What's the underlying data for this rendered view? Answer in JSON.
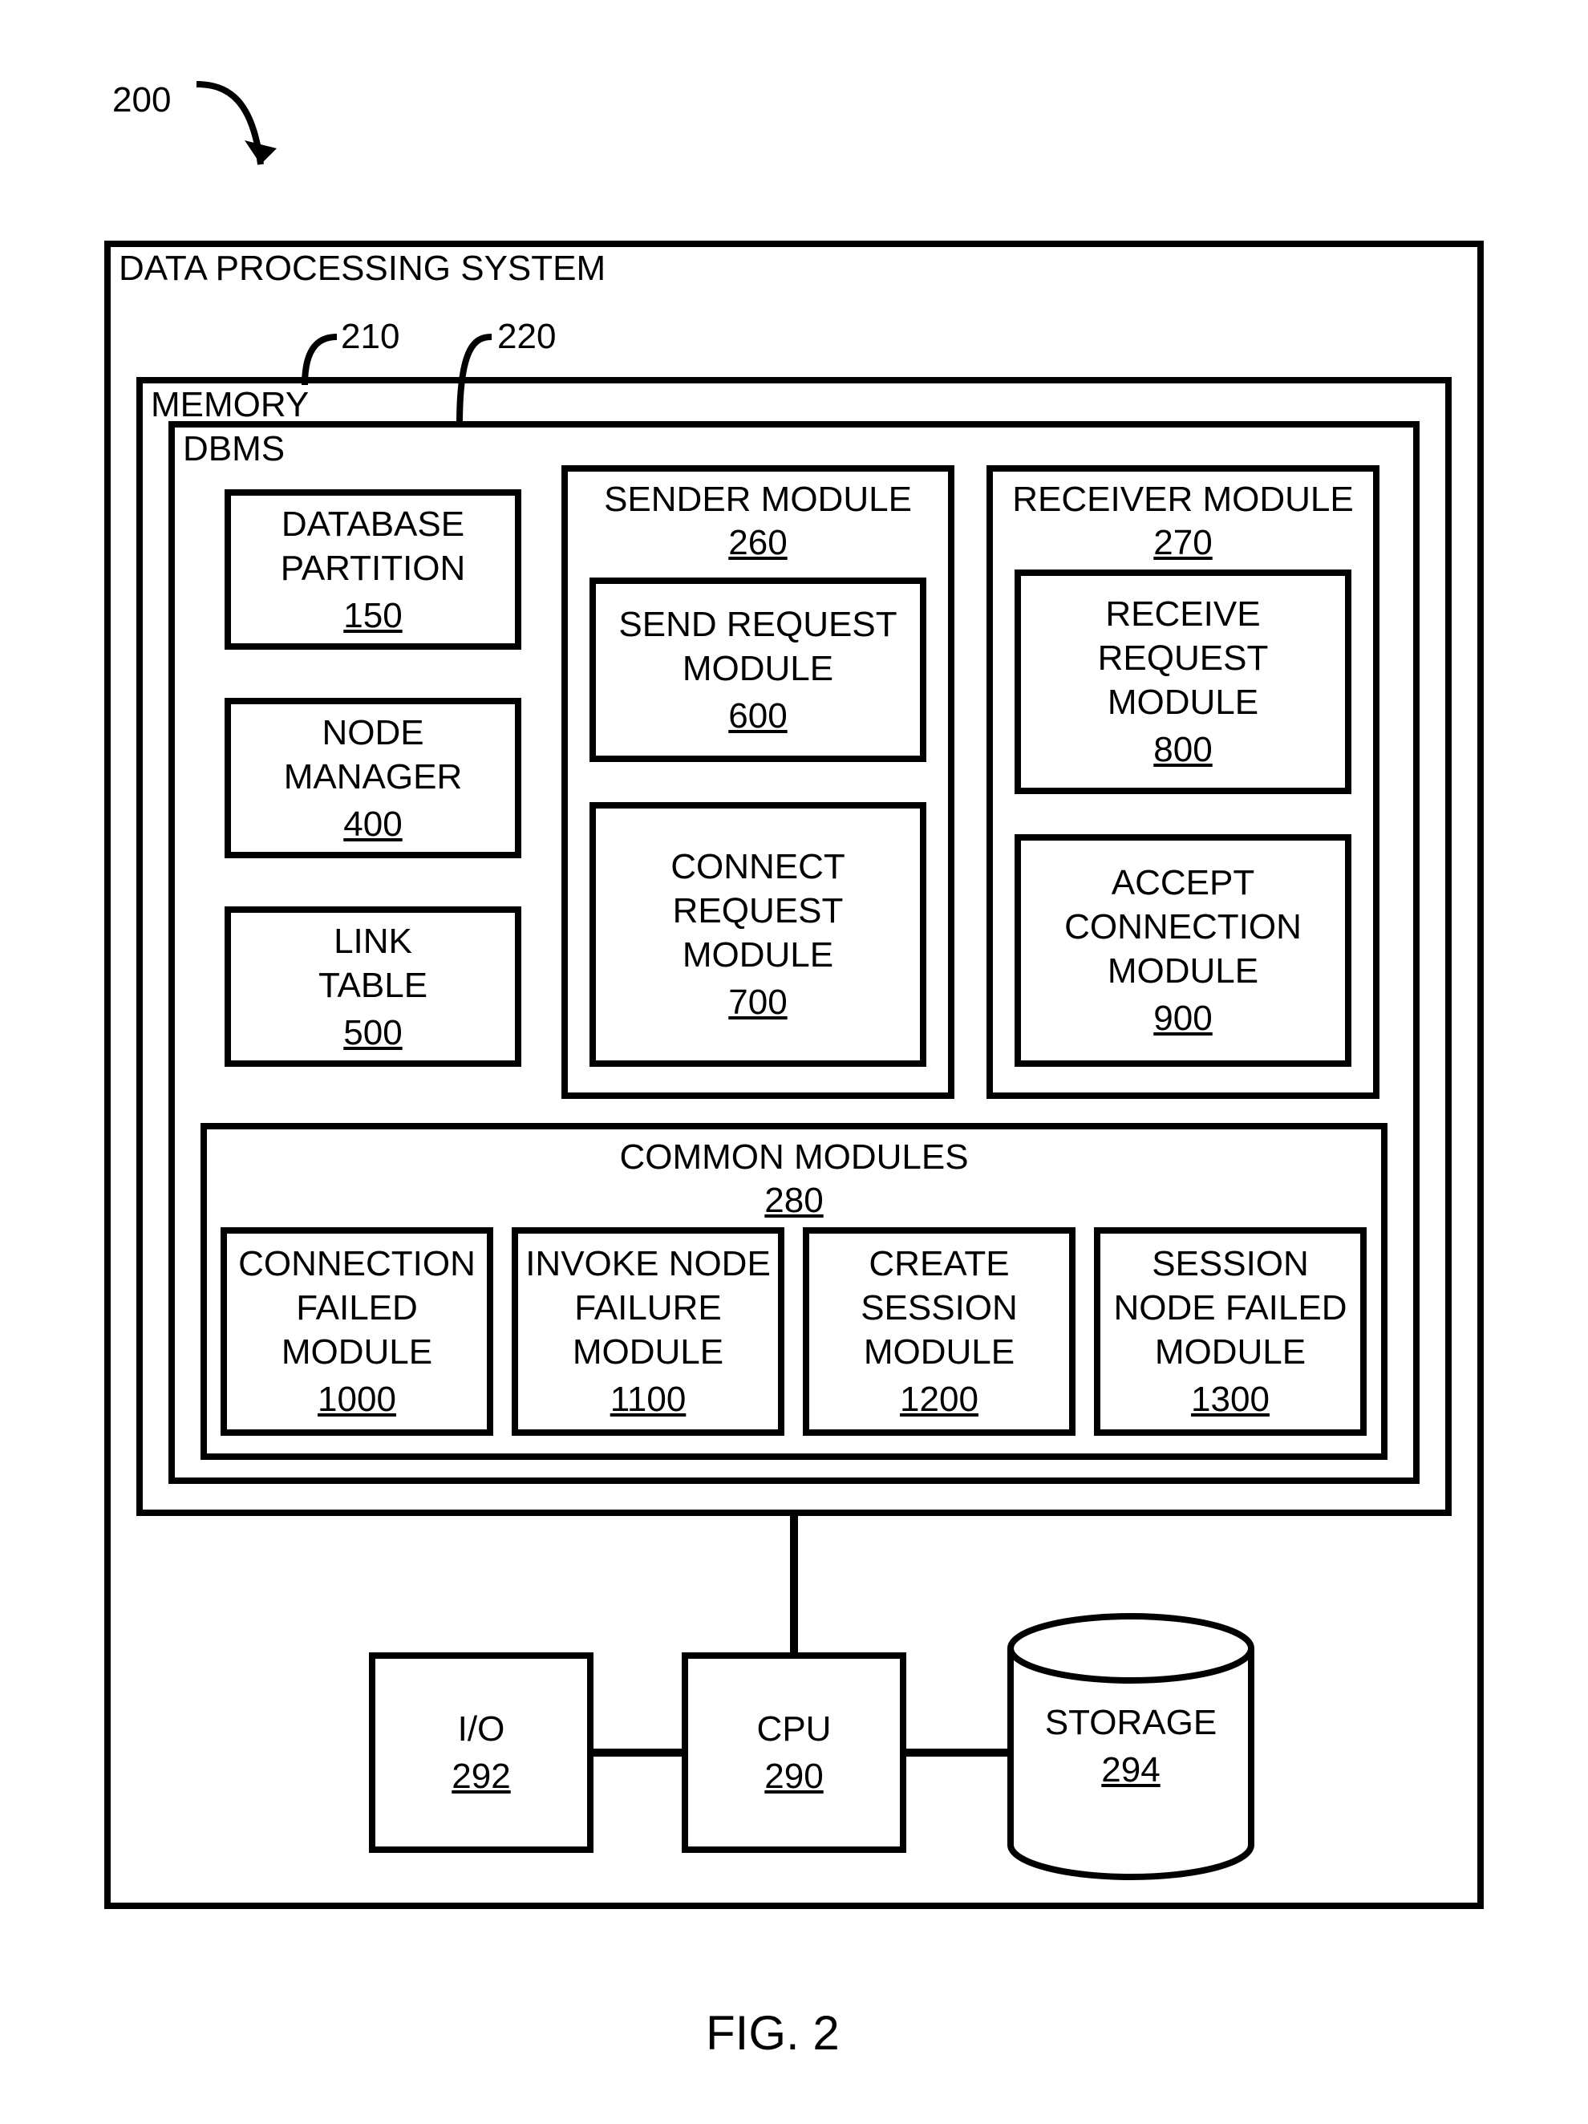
{
  "figure_ref": "200",
  "figure_caption": "FIG. 2",
  "callouts": {
    "memory": "210",
    "dbms": "220"
  },
  "outer": {
    "title": "DATA PROCESSING SYSTEM"
  },
  "memory": {
    "title": "MEMORY"
  },
  "dbms": {
    "title": "DBMS"
  },
  "left": {
    "db_partition": {
      "title1": "DATABASE",
      "title2": "PARTITION",
      "ref": "150"
    },
    "node_manager": {
      "title1": "NODE",
      "title2": "MANAGER",
      "ref": "400"
    },
    "link_table": {
      "title1": "LINK",
      "title2": "TABLE",
      "ref": "500"
    }
  },
  "sender": {
    "title": "SENDER MODULE",
    "ref": "260",
    "send": {
      "title1": "SEND REQUEST",
      "title2": "MODULE",
      "ref": "600"
    },
    "connect": {
      "title1": "CONNECT",
      "title2": "REQUEST",
      "title3": "MODULE",
      "ref": "700"
    }
  },
  "receiver": {
    "title": "RECEIVER MODULE",
    "ref": "270",
    "receive": {
      "title1": "RECEIVE",
      "title2": "REQUEST",
      "title3": "MODULE",
      "ref": "800"
    },
    "accept": {
      "title1": "ACCEPT",
      "title2": "CONNECTION",
      "title3": "MODULE",
      "ref": "900"
    }
  },
  "common": {
    "title": "COMMON MODULES",
    "ref": "280",
    "m1": {
      "title1": "CONNECTION",
      "title2": "FAILED",
      "title3": "MODULE",
      "ref": "1000"
    },
    "m2": {
      "title1": "INVOKE NODE",
      "title2": "FAILURE",
      "title3": "MODULE",
      "ref": "1100"
    },
    "m3": {
      "title1": "CREATE",
      "title2": "SESSION",
      "title3": "MODULE",
      "ref": "1200"
    },
    "m4": {
      "title1": "SESSION",
      "title2": "NODE FAILED",
      "title3": "MODULE",
      "ref": "1300"
    }
  },
  "io": {
    "title": "I/O",
    "ref": "292"
  },
  "cpu": {
    "title": "CPU",
    "ref": "290"
  },
  "storage": {
    "title": "STORAGE",
    "ref": "294"
  }
}
